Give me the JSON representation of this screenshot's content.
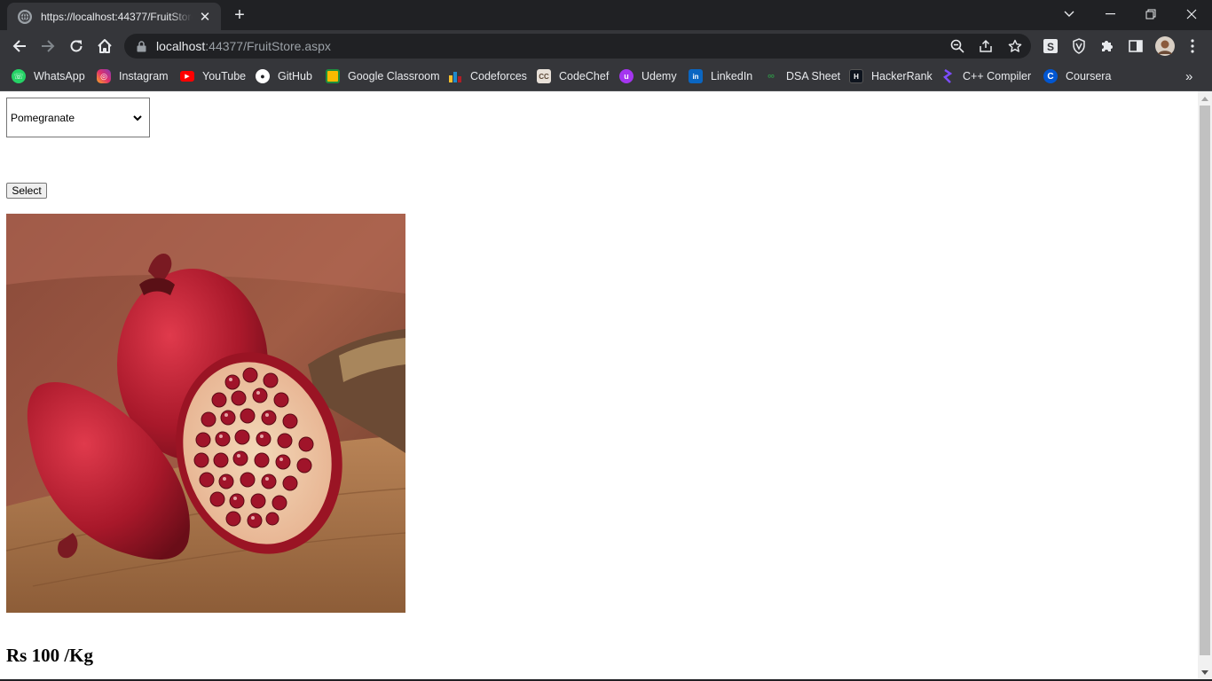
{
  "browser": {
    "tab": {
      "title": "https://localhost:44377/FruitStore.aspx"
    },
    "address": {
      "host": "localhost",
      "rest": ":44377/FruitStore.aspx"
    },
    "bookmarks": [
      {
        "label": "WhatsApp",
        "icon": "whatsapp-icon",
        "color": "#25d366"
      },
      {
        "label": "Instagram",
        "icon": "instagram-icon",
        "color": "#e1306c"
      },
      {
        "label": "YouTube",
        "icon": "youtube-icon",
        "color": "#ff0000"
      },
      {
        "label": "GitHub",
        "icon": "github-icon",
        "color": "#ffffff"
      },
      {
        "label": "Google Classroom",
        "icon": "classroom-icon",
        "color": "#f9bb00"
      },
      {
        "label": "Codeforces",
        "icon": "codeforces-icon",
        "color": "#1f8acb"
      },
      {
        "label": "CodeChef",
        "icon": "codechef-icon",
        "color": "#8c6a4f"
      },
      {
        "label": "Udemy",
        "icon": "udemy-icon",
        "color": "#a435f0"
      },
      {
        "label": "LinkedIn",
        "icon": "linkedin-icon",
        "color": "#0a66c2"
      },
      {
        "label": "DSA Sheet",
        "icon": "dsa-sheet-icon",
        "color": "#2f8d46"
      },
      {
        "label": "HackerRank",
        "icon": "hackerrank-icon",
        "color": "#0e141e"
      },
      {
        "label": "C++ Compiler",
        "icon": "cpp-compiler-icon",
        "color": "#7c4dff"
      },
      {
        "label": "Coursera",
        "icon": "coursera-icon",
        "color": "#0056d2"
      }
    ]
  },
  "page": {
    "fruit_select": {
      "selected": "Pomegranate"
    },
    "select_button": "Select",
    "price": "Rs 100 /Kg"
  }
}
